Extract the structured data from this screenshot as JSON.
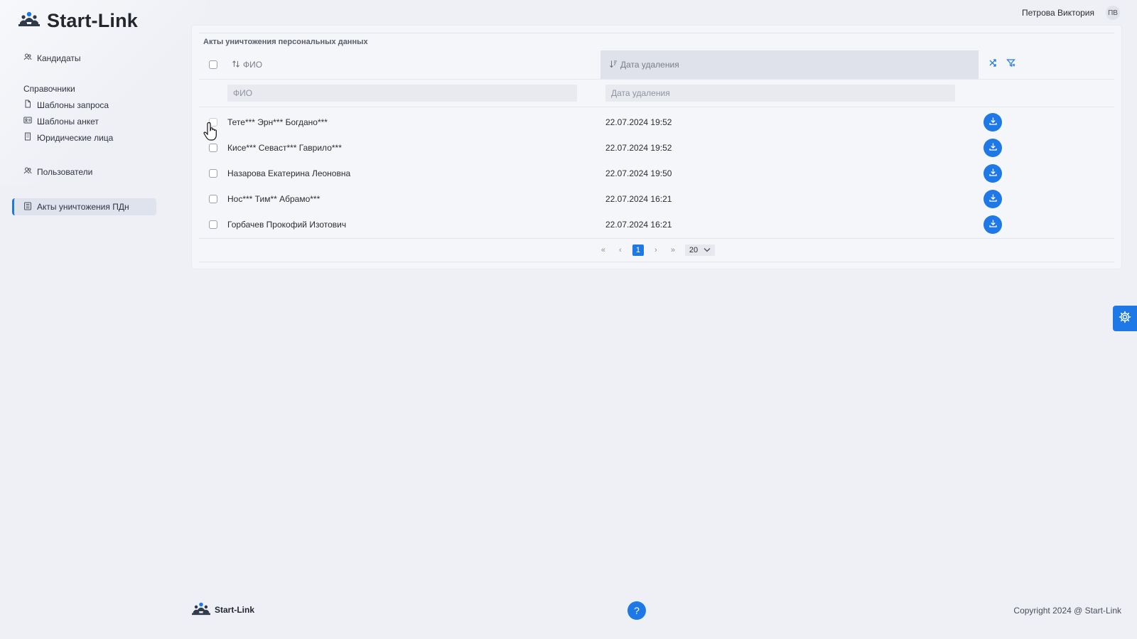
{
  "app": {
    "title": "Start-Link"
  },
  "user": {
    "name": "Петрова Виктория",
    "initials": "ПВ"
  },
  "nav": {
    "candidates": "Кандидаты",
    "section_references": "Справочники",
    "request_templates": "Шаблоны запроса",
    "form_templates": "Шаблоны анкет",
    "legal_entities": "Юридические лица",
    "users": "Пользователи",
    "destruction_acts": "Акты уничтожения ПДн"
  },
  "page": {
    "title": "Акты уничтожения персональных данных",
    "columns": {
      "fio": "ФИО",
      "date": "Дата удаления"
    },
    "filters": {
      "fio_placeholder": "ФИО",
      "date_placeholder": "Дата удаления"
    },
    "rows": [
      {
        "fio": "Тете*** Эрн*** Богдано***",
        "date": "22.07.2024 19:52"
      },
      {
        "fio": "Кисе*** Севаст*** Гаврило***",
        "date": "22.07.2024 19:52"
      },
      {
        "fio": "Назарова Екатерина Леоновна",
        "date": "22.07.2024 19:50"
      },
      {
        "fio": "Нос*** Тим** Абрамо***",
        "date": "22.07.2024 16:21"
      },
      {
        "fio": "Горбачев Прокофий Изотович",
        "date": "22.07.2024 16:21"
      }
    ],
    "pagination": {
      "current_page": "1",
      "page_size": "20"
    }
  },
  "footer": {
    "brand": "Start-Link",
    "copyright": "Copyright 2024 @ Start-Link",
    "help": "?"
  },
  "colors": {
    "accent": "#1e78e6",
    "background": "#eef0f6"
  }
}
